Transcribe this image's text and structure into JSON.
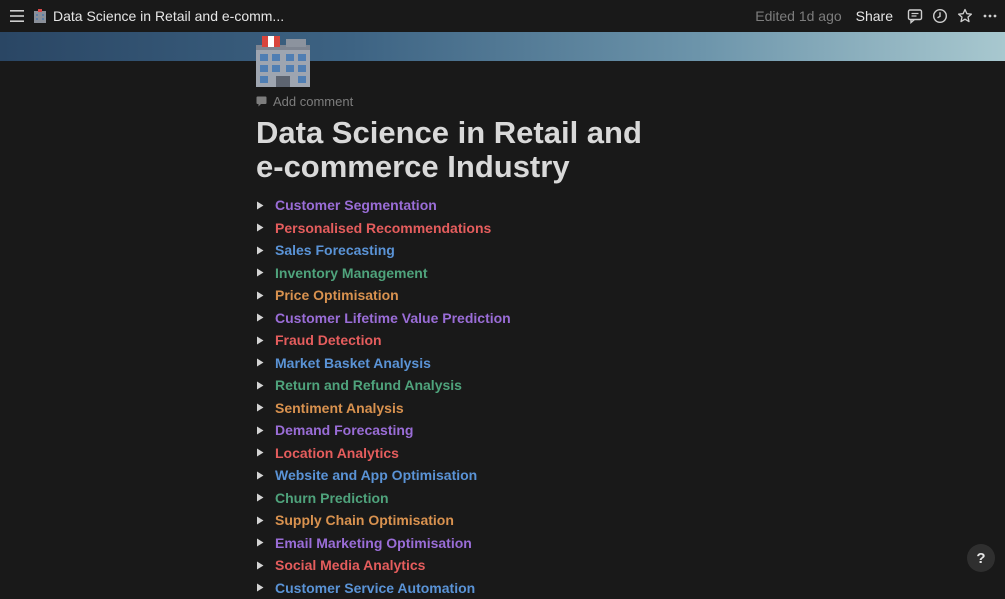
{
  "topbar": {
    "title": "Data Science in Retail and e-comm...",
    "edited": "Edited 1d ago",
    "share": "Share"
  },
  "page": {
    "add_comment": "Add comment",
    "title": "Data Science in Retail and e-commerce Industry",
    "page_icon": "office-building-icon"
  },
  "colors": {
    "purple": "#9a6dd7",
    "red": "#e55d5d",
    "blue": "#5a93d6",
    "green": "#4fa37c",
    "orange": "#d9924f"
  },
  "toggles": [
    {
      "label": "Customer Segmentation",
      "color": "purple"
    },
    {
      "label": "Personalised Recommendations",
      "color": "red"
    },
    {
      "label": "Sales Forecasting",
      "color": "blue"
    },
    {
      "label": "Inventory Management",
      "color": "green"
    },
    {
      "label": "Price Optimisation",
      "color": "orange"
    },
    {
      "label": "Customer Lifetime Value Prediction",
      "color": "purple"
    },
    {
      "label": "Fraud Detection",
      "color": "red"
    },
    {
      "label": "Market Basket Analysis",
      "color": "blue"
    },
    {
      "label": "Return and Refund Analysis",
      "color": "green"
    },
    {
      "label": "Sentiment Analysis",
      "color": "orange"
    },
    {
      "label": "Demand Forecasting",
      "color": "purple"
    },
    {
      "label": "Location Analytics",
      "color": "red"
    },
    {
      "label": "Website and App Optimisation",
      "color": "blue"
    },
    {
      "label": "Churn Prediction",
      "color": "green"
    },
    {
      "label": "Supply Chain Optimisation",
      "color": "orange"
    },
    {
      "label": "Email Marketing Optimisation",
      "color": "purple"
    },
    {
      "label": "Social Media Analytics",
      "color": "red"
    },
    {
      "label": "Customer Service Automation",
      "color": "blue"
    }
  ],
  "help": "?"
}
